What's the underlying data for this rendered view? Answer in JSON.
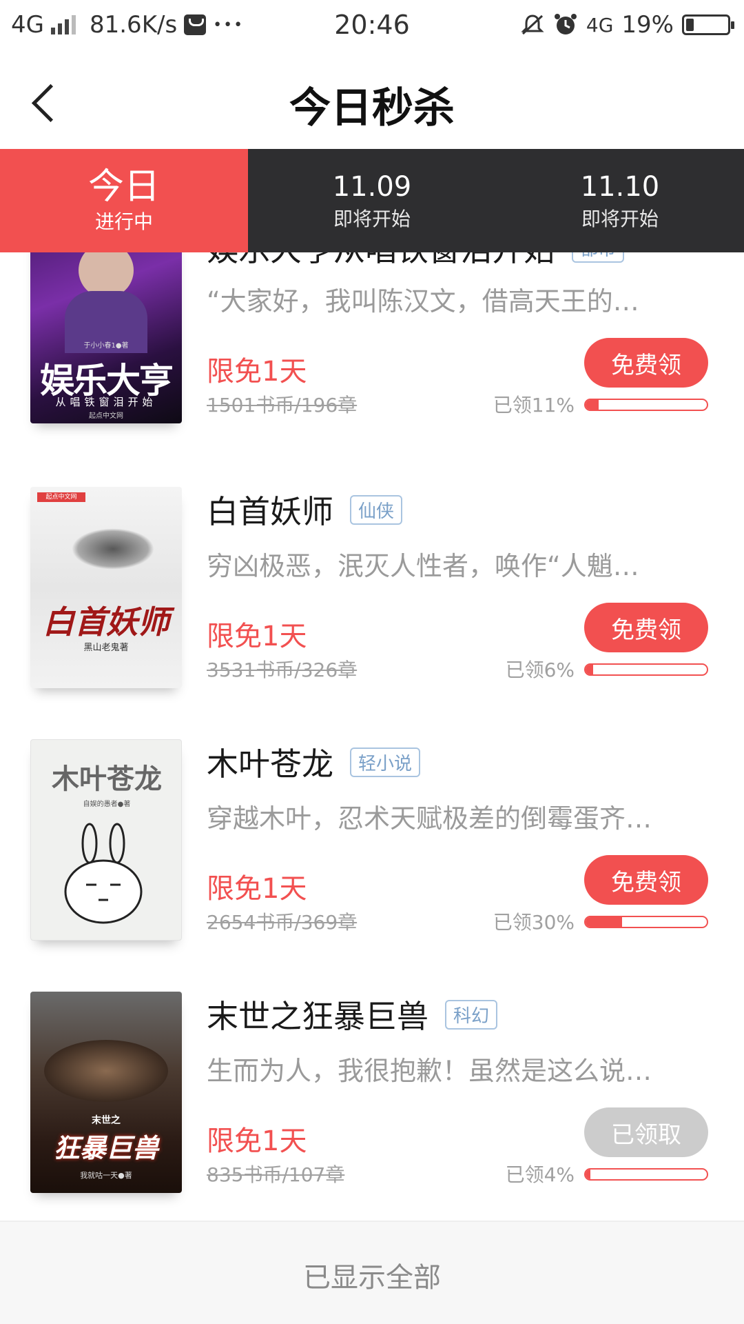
{
  "status_bar": {
    "network": "4G",
    "speed": "81.6K/s",
    "more": "•••",
    "time": "20:46",
    "network2": "4G",
    "battery": "19%",
    "battery_level": 0.19,
    "icons": [
      "signal-icon",
      "message-icon",
      "mute-icon",
      "alarm-icon",
      "battery-icon"
    ]
  },
  "header": {
    "title": "今日秒杀",
    "back_icon": "chevron-left-icon"
  },
  "tabs": [
    {
      "main": "今日",
      "sub": "进行中",
      "active": true
    },
    {
      "main": "11.09",
      "sub": "即将开始",
      "active": false
    },
    {
      "main": "11.10",
      "sub": "即将开始",
      "active": false
    }
  ],
  "books": [
    {
      "title": "娱乐大亨从唱铁窗泪开始",
      "tag": "都市",
      "desc": "“大家好，我叫陈汉文，借高天王的…",
      "free": "限免1天",
      "price": "1501书币/196章",
      "claimed": "已领11%",
      "claimed_fraction": 0.11,
      "button": "免费领",
      "button_state": "active",
      "cover": {
        "main": "娱乐大亨",
        "sub": "从唱铁窗泪开始",
        "author": "于小小春1●著",
        "brand": "起点中文网"
      }
    },
    {
      "title": "白首妖师",
      "tag": "仙侠",
      "desc": "穷凶极恶，泯灭人性者，唤作“人魈…",
      "free": "限免1天",
      "price": "3531书币/326章",
      "claimed": "已领6%",
      "claimed_fraction": 0.06,
      "button": "免费领",
      "button_state": "active",
      "cover": {
        "main": "白首妖师",
        "author": "黑山老鬼著",
        "brand": "起点中文网"
      }
    },
    {
      "title": "木叶苍龙",
      "tag": "轻小说",
      "desc": "穿越木叶，忍术天赋极差的倒霉蛋齐…",
      "free": "限免1天",
      "price": "2654书币/369章",
      "claimed": "已领30%",
      "claimed_fraction": 0.3,
      "button": "免费领",
      "button_state": "active",
      "cover": {
        "main": "木叶苍龙",
        "author": "自娱的愚者●著"
      }
    },
    {
      "title": "末世之狂暴巨兽",
      "tag": "科幻",
      "desc": "生而为人，我很抱歉！虽然是这么说…",
      "free": "限免1天",
      "price": "835书币/107章",
      "claimed": "已领4%",
      "claimed_fraction": 0.04,
      "button": "已领取",
      "button_state": "done",
      "cover": {
        "main": "狂暴巨兽",
        "sub": "末世之",
        "author": "我就咕一天●著"
      }
    }
  ],
  "footer": {
    "text": "已显示全部"
  },
  "colors": {
    "accent": "#f25050",
    "tab_bg": "#2e2e30",
    "tag": "#7aa0c8",
    "muted": "#a0a0a0"
  }
}
